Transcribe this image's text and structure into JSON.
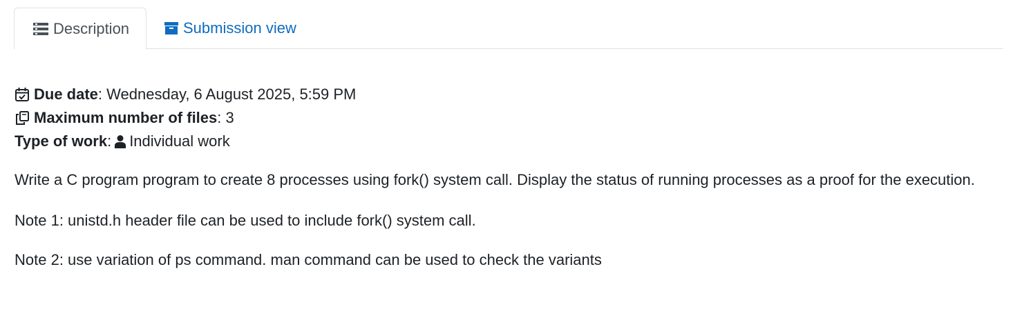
{
  "tabs": [
    {
      "label": "Description",
      "icon": "list-icon",
      "active": true
    },
    {
      "label": "Submission view",
      "icon": "archive-box-icon",
      "active": false
    }
  ],
  "info": {
    "due_date": {
      "label": "Due date",
      "sep": ":",
      "value": "Wednesday, 6 August 2025, 5:59 PM",
      "icon": "calendar-check-icon"
    },
    "max_files": {
      "label": "Maximum number of files",
      "sep": ":",
      "value": "3",
      "icon": "copy-files-icon"
    },
    "type_of_work": {
      "label": "Type of work",
      "sep": ":",
      "value": "Individual work",
      "icon": "user-icon"
    }
  },
  "description": {
    "paragraph1": "Write a C program program to create 8 processes using fork() system call. Display the status of running processes as a proof for the execution.",
    "paragraph2": "Note 1: unistd.h header file can be used to include fork() system call.",
    "paragraph3": "Note 2: use variation of ps command. man command can be used to check the variants"
  },
  "colors": {
    "link": "#0f6cbf",
    "text": "#1d2125",
    "tab_border": "#dee2e6",
    "inactive_tab_text": "#495057"
  }
}
